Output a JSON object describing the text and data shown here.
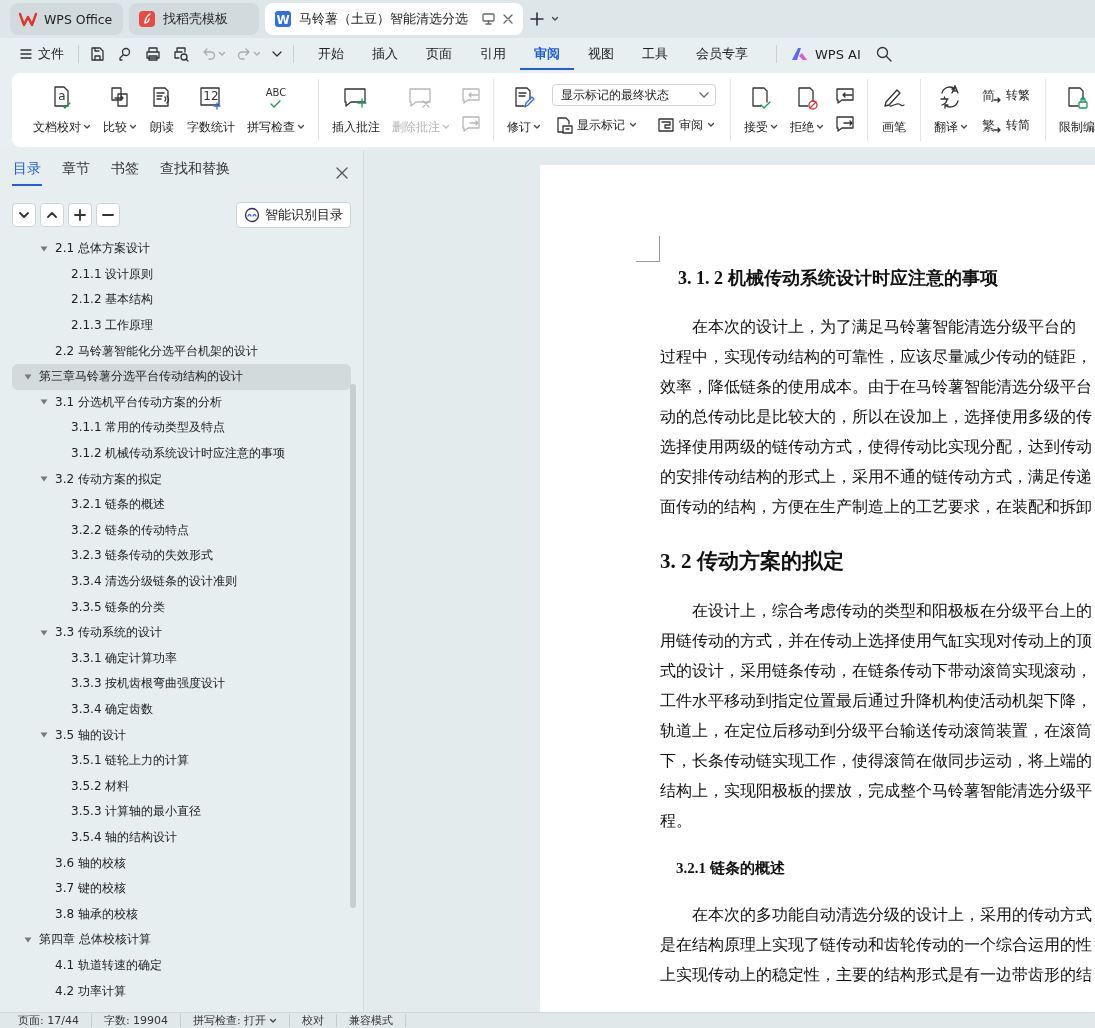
{
  "tabs": [
    {
      "kind": "home",
      "label": "WPS Office",
      "selected": false
    },
    {
      "kind": "templates",
      "label": "找稻壳模板",
      "selected": false
    },
    {
      "kind": "document",
      "label": "马铃薯（土豆）智能清选分选",
      "icon_text": "W",
      "selected": true
    }
  ],
  "menu": {
    "file": "文件",
    "tabs": [
      {
        "label": "开始",
        "selected": false
      },
      {
        "label": "插入",
        "selected": false
      },
      {
        "label": "页面",
        "selected": false
      },
      {
        "label": "引用",
        "selected": false
      },
      {
        "label": "审阅",
        "selected": true
      },
      {
        "label": "视图",
        "selected": false
      },
      {
        "label": "工具",
        "selected": false
      },
      {
        "label": "会员专享",
        "selected": false
      }
    ],
    "ai": "WPS AI"
  },
  "ribbon": {
    "groups": [
      {
        "items": [
          {
            "kind": "large",
            "label": "文档校对",
            "icon_text": "a",
            "dropdown": true,
            "disabled": false
          },
          {
            "kind": "large",
            "label": "比较",
            "dropdown": true,
            "disabled": false
          },
          {
            "kind": "large",
            "label": "朗读",
            "dropdown": false,
            "disabled": false
          },
          {
            "kind": "large",
            "label": "字数统计",
            "icon_text": "12",
            "dropdown": false,
            "disabled": false
          },
          {
            "kind": "large",
            "label": "拼写检查",
            "icon_text": "ABC",
            "dropdown": true,
            "disabled": false
          }
        ]
      },
      {
        "items": [
          {
            "kind": "large",
            "label": "插入批注",
            "dropdown": false,
            "disabled": false
          },
          {
            "kind": "large",
            "label": "删除批注",
            "dropdown": true,
            "disabled": true
          },
          {
            "kind": "icons",
            "buttons": [
              {
                "disabled": true
              },
              {
                "disabled": true
              }
            ]
          }
        ]
      },
      {
        "items": [
          {
            "kind": "large",
            "label": "修订",
            "dropdown": true,
            "disabled": false
          },
          {
            "kind": "review",
            "select": "显示标记的最终状态",
            "buttons": [
              {
                "label": "显示标记",
                "dropdown": true,
                "disabled": false
              },
              {
                "label": "审阅",
                "dropdown": true,
                "disabled": false
              }
            ]
          }
        ]
      },
      {
        "items": [
          {
            "kind": "large",
            "label": "接受",
            "dropdown": true,
            "disabled": false
          },
          {
            "kind": "large",
            "label": "拒绝",
            "dropdown": true,
            "disabled": false
          },
          {
            "kind": "icons",
            "buttons": [
              {
                "disabled": false
              },
              {
                "disabled": false
              }
            ]
          }
        ]
      },
      {
        "items": [
          {
            "kind": "large",
            "label": "画笔",
            "dropdown": false,
            "disabled": false
          }
        ]
      },
      {
        "items": [
          {
            "kind": "large",
            "label": "翻译",
            "dropdown": true,
            "disabled": false
          },
          {
            "kind": "stack",
            "buttons": [
              {
                "label": "转繁",
                "icon_text": "简",
                "dropdown": false,
                "disabled": false
              },
              {
                "label": "转简",
                "icon_text": "繁",
                "dropdown": false,
                "disabled": false
              }
            ]
          }
        ]
      },
      {
        "items": [
          {
            "kind": "large",
            "label": "限制编",
            "dropdown": false,
            "disabled": false
          }
        ]
      }
    ]
  },
  "sidebar": {
    "tabs": [
      {
        "label": "目录",
        "selected": true
      },
      {
        "label": "章节",
        "selected": false
      },
      {
        "label": "书签",
        "selected": false
      },
      {
        "label": "查找和替换",
        "selected": false
      }
    ],
    "smart_button": "智能识别目录",
    "toc": {
      "continued": [
        {
          "label": "2.1  总体方案设计",
          "selected": false,
          "expanded": true,
          "children": [
            {
              "label": "2.1.1  设计原则",
              "selected": false,
              "expanded": false
            },
            {
              "label": "2.1.2  基本结构",
              "selected": false,
              "expanded": false
            },
            {
              "label": "2.1.3  工作原理",
              "selected": false,
              "expanded": false
            }
          ]
        },
        {
          "label": "2.2 马铃薯智能化分选平台机架的设计",
          "selected": false,
          "expanded": false
        }
      ],
      "chapters": [
        {
          "label": "第三章马铃薯分选平台传动结构的设计",
          "selected": true,
          "expanded": true,
          "children": [
            {
              "label": "3.1 分选机平台传动方案的分析",
              "selected": false,
              "expanded": true,
              "children": [
                {
                  "label": "3.1.1 常用的传动类型及特点",
                  "selected": false,
                  "expanded": false
                },
                {
                  "label": "3.1.2 机械传动系统设计时应注意的事项",
                  "selected": false,
                  "expanded": false
                }
              ]
            },
            {
              "label": "3.2 传动方案的拟定",
              "selected": false,
              "expanded": true,
              "children": [
                {
                  "label": "3.2.1 链条的概述",
                  "selected": false,
                  "expanded": false
                },
                {
                  "label": "3.2.2 链条的传动特点",
                  "selected": false,
                  "expanded": false
                },
                {
                  "label": "3.2.3 链条传动的失效形式",
                  "selected": false,
                  "expanded": false
                },
                {
                  "label": "3.3.4  清选分级链条的设计准则",
                  "selected": false,
                  "expanded": false
                },
                {
                  "label": "3.3.5 链条的分类",
                  "selected": false,
                  "expanded": false
                }
              ]
            },
            {
              "label": "3.3 传动系统的设计",
              "selected": false,
              "expanded": true,
              "children": [
                {
                  "label": "3.3.1 确定计算功率",
                  "selected": false,
                  "expanded": false
                },
                {
                  "label": "3.3.3 按机齿根弯曲强度设计",
                  "selected": false,
                  "expanded": false
                },
                {
                  "label": "3.3.4 确定齿数",
                  "selected": false,
                  "expanded": false
                }
              ]
            },
            {
              "label": "3.5 轴的设计",
              "selected": false,
              "expanded": true,
              "children": [
                {
                  "label": "3.5.1 链轮上力的计算",
                  "selected": false,
                  "expanded": false
                },
                {
                  "label": "3.5.2 材料",
                  "selected": false,
                  "expanded": false
                },
                {
                  "label": "3.5.3 计算轴的最小直径",
                  "selected": false,
                  "expanded": false
                },
                {
                  "label": "3.5.4 轴的结构设计",
                  "selected": false,
                  "expanded": false
                }
              ]
            },
            {
              "label": "3.6 轴的校核",
              "selected": false,
              "expanded": false
            },
            {
              "label": "3.7 键的校核",
              "selected": false,
              "expanded": false
            },
            {
              "label": "3.8 轴承的校核",
              "selected": false,
              "expanded": false
            }
          ]
        },
        {
          "label": "第四章  总体校核计算",
          "selected": false,
          "expanded": true,
          "children": [
            {
              "label": "4.1  轨道转速的确定",
              "selected": false,
              "expanded": false
            },
            {
              "label": "4.2  功率计算",
              "selected": false,
              "expanded": false
            }
          ]
        }
      ]
    }
  },
  "document": {
    "blocks": [
      {
        "kind": "h3",
        "text": "3. 1. 2 机械传动系统设计时应注意的事项"
      },
      {
        "kind": "para",
        "lines": [
          "在本次的设计上，为了满足马铃薯智能清选分级平台的",
          "过程中，实现传动结构的可靠性，应该尽量减少传动的链距，",
          "效率，降低链条的使用成本。由于在马铃薯智能清选分级平台",
          "动的总传动比是比较大的，所以在设加上，选择使用多级的传",
          "选择使用两级的链传动方式，使得传动比实现分配，达到传动",
          "的安排传动结构的形式上，采用不通的链传动方式，满足传递",
          "面传动的结构，方便在生产制造上的工艺要求，在装配和拆卸"
        ]
      },
      {
        "kind": "h2",
        "text": "3. 2 传动方案的拟定"
      },
      {
        "kind": "para",
        "lines": [
          "在设计上，综合考虑传动的类型和阳极板在分级平台上的",
          "用链传动的方式，并在传动上选择使用气缸实现对传动上的顶",
          "式的设计，采用链条传动，在链条传动下带动滚筒实现滚动，",
          "工件水平移动到指定位置最后通过升降机构使活动机架下降，",
          "轨道上，在定位后移动到分级平台输送传动滚筒装置，在滚筒",
          "下，长条传动链实现工作，使得滚筒在做同步运动，将上端的",
          "结构上，实现阳极板的摆放，完成整个马铃薯智能清选分级平",
          "程。"
        ]
      },
      {
        "kind": "h4",
        "text": "3.2.1 链条的概述"
      },
      {
        "kind": "para",
        "lines": [
          "在本次的多功能自动清选分级的设计上，采用的传动方式",
          "是在结构原理上实现了链传动和齿轮传动的一个综合运用的性",
          "上实现传动上的稳定性，主要的结构形式是有一边带齿形的结"
        ]
      }
    ]
  },
  "status": [
    {
      "label": "页面: 17/44",
      "dropdown": false
    },
    {
      "label": "字数: 19904",
      "dropdown": false
    },
    {
      "label": "拼写检查: 打开",
      "dropdown": true
    },
    {
      "label": "校对",
      "dropdown": false
    },
    {
      "label": "兼容模式",
      "dropdown": false
    }
  ]
}
